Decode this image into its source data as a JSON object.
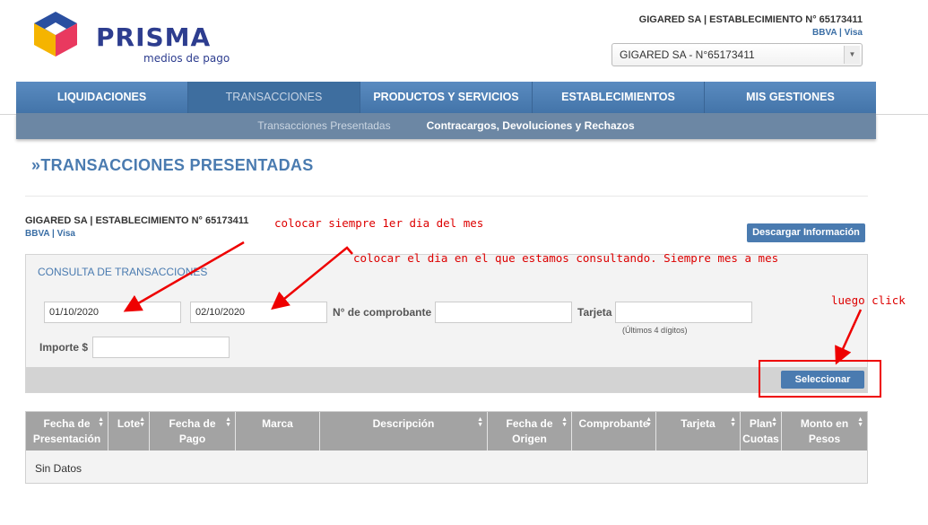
{
  "brand": {
    "name": "PRISMA",
    "tagline": "medios de pago"
  },
  "header": {
    "title": "GIGARED SA  | ESTABLECIMIENTO N° 65173411",
    "subtitle": "BBVA | Visa",
    "select_value": "GIGARED SA - N°65173411"
  },
  "nav": {
    "items": [
      "LIQUIDACIONES",
      "TRANSACCIONES",
      "PRODUCTOS Y SERVICIOS",
      "ESTABLECIMIENTOS",
      "MIS GESTIONES"
    ],
    "active": "TRANSACCIONES"
  },
  "subnav": {
    "items": [
      "Transacciones Presentadas",
      "Contracargos, Devoluciones y Rechazos"
    ]
  },
  "page": {
    "title": "TRANSACCIONES PRESENTADAS",
    "title_marker": "»",
    "establishment": "GIGARED SA  | ESTABLECIMIENTO N° 65173411",
    "establishment_sub": "BBVA | Visa",
    "download_button": "Descargar Información"
  },
  "query": {
    "title": "CONSULTA DE TRANSACCIONES",
    "date_from": "01/10/2020",
    "date_to": "02/10/2020",
    "voucher_label": "N° de comprobante",
    "voucher_value": "",
    "card_label": "Tarjeta",
    "card_value": "",
    "card_hint": "(Últimos 4 dígitos)",
    "amount_label": "Importe $",
    "amount_value": "",
    "select_button": "Seleccionar"
  },
  "table": {
    "columns": [
      [
        "Fecha de",
        "Presentación"
      ],
      [
        "Lote"
      ],
      [
        "Fecha de",
        "Pago"
      ],
      [
        "Marca"
      ],
      [
        "Descripción"
      ],
      [
        "Fecha de",
        "Origen"
      ],
      [
        "Comprobante"
      ],
      [
        "Tarjeta"
      ],
      [
        "Plan",
        "Cuotas"
      ],
      [
        "Monto en",
        "Pesos"
      ]
    ],
    "empty_text": "Sin Datos"
  },
  "annotations": {
    "note1": "colocar siempre 1er dia del mes",
    "note2": "colocar el dia en el que estamos consultando. Siempre mes a mes",
    "note3": "luego click"
  },
  "colors": {
    "brand_blue": "#2d3d8f",
    "nav_blue": "#4a7bb0",
    "annotation_red": "#dd0000"
  }
}
